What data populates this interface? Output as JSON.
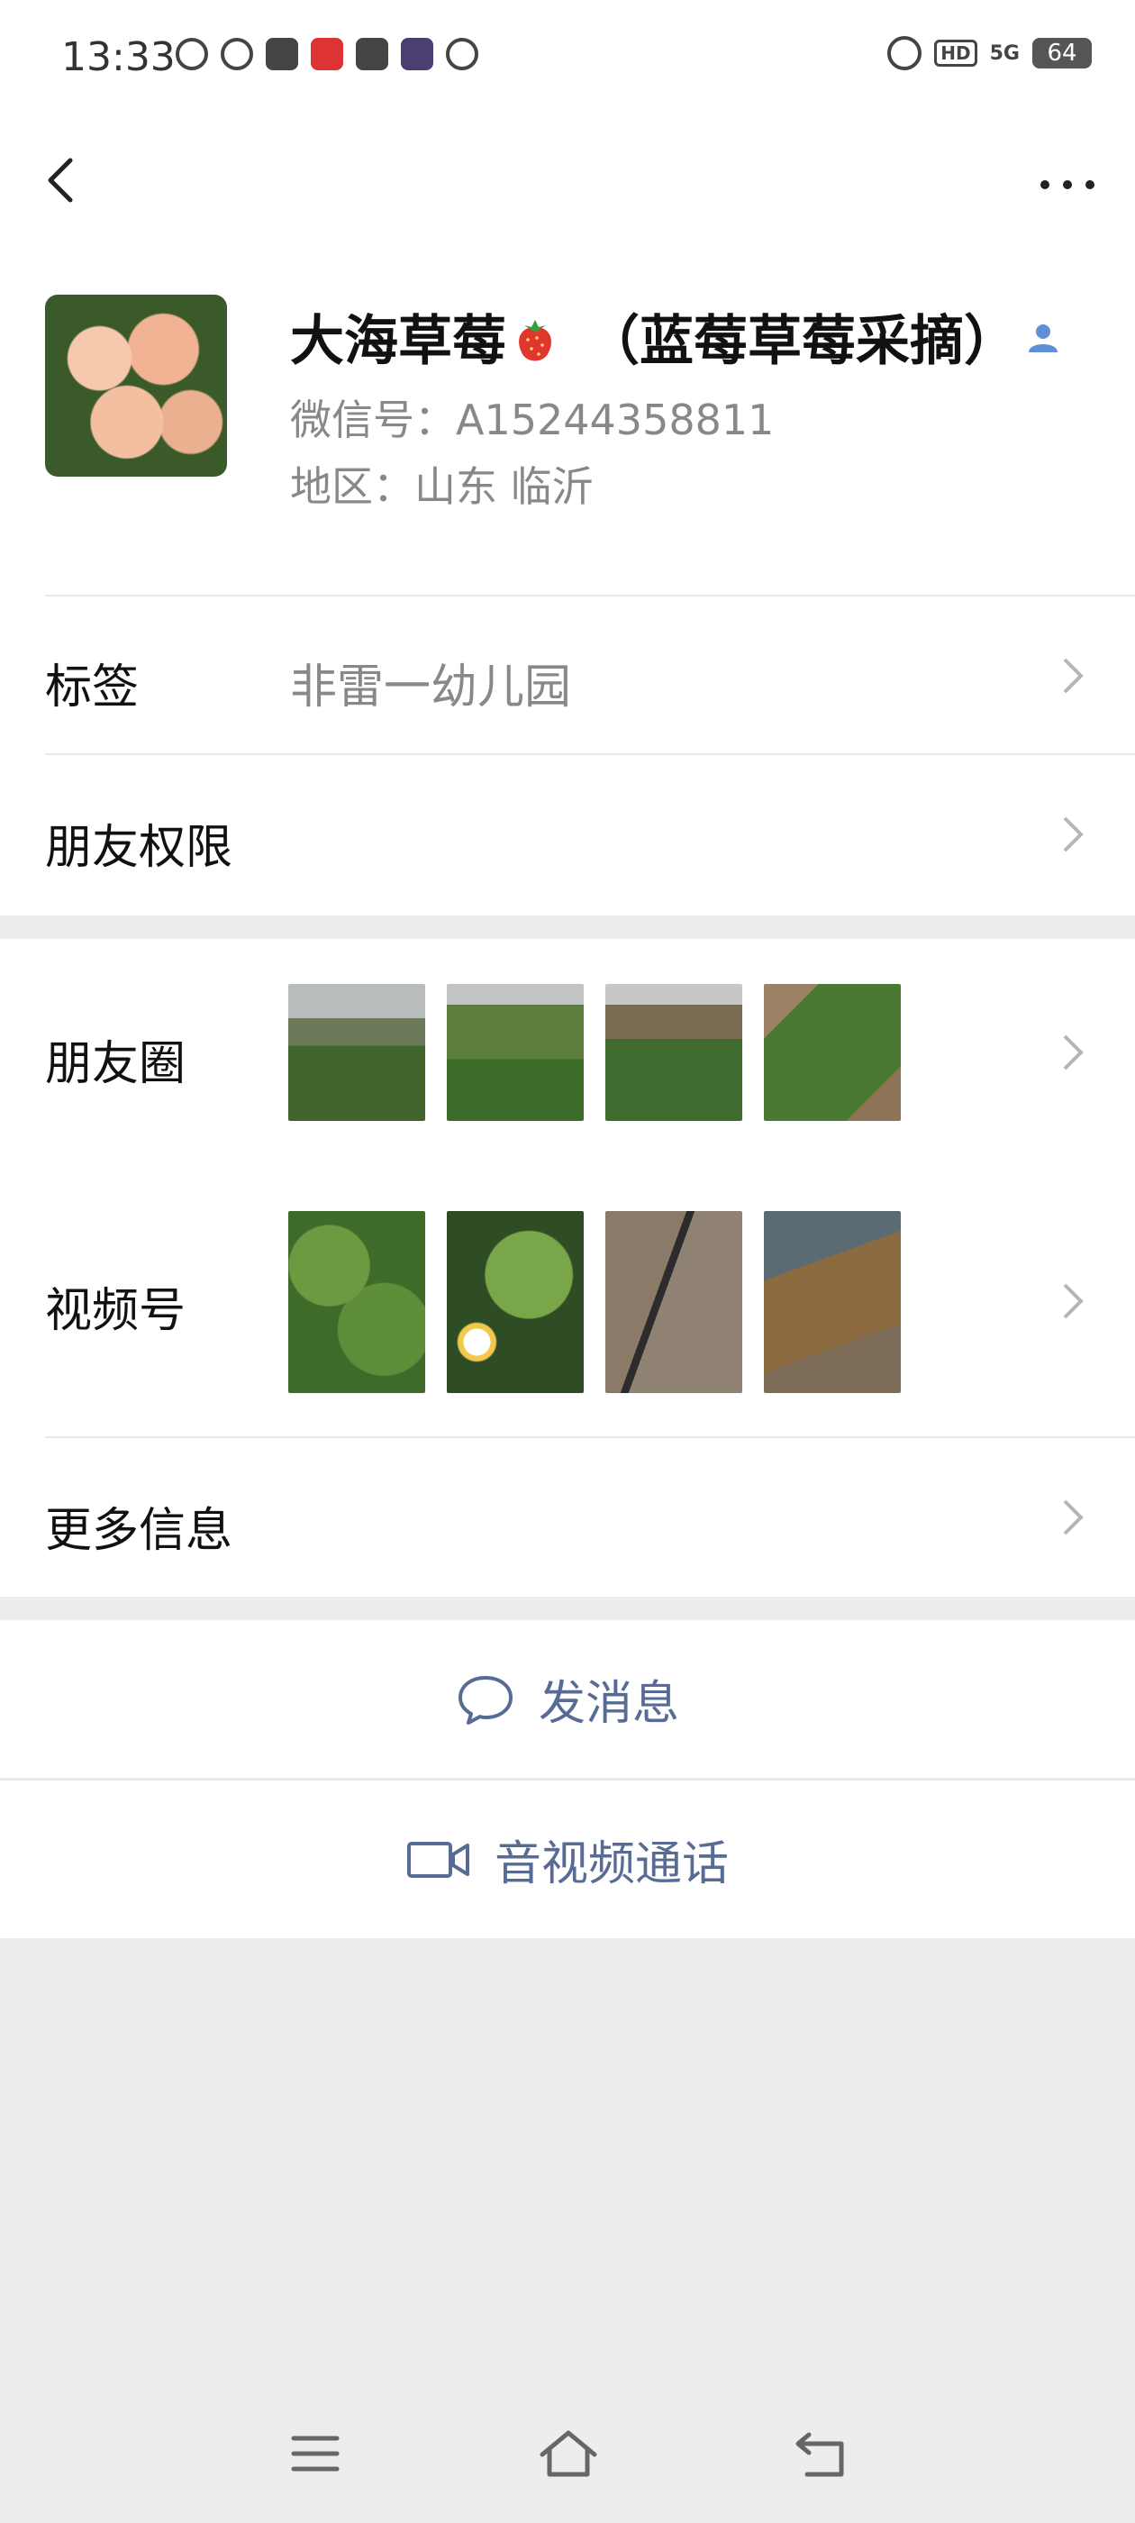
{
  "status_bar": {
    "time": "13:33",
    "battery": "64",
    "network": "5G",
    "hd": "HD"
  },
  "nav": {
    "back_icon": "chevron-left-icon",
    "more_icon": "more-dots-icon"
  },
  "profile": {
    "name": "大海草莓",
    "name_suffix": "（蓝莓草莓采摘）",
    "wechat_id": "微信号：A15244358811",
    "region": "地区：山东  临沂"
  },
  "rows": {
    "tag_label": "标签",
    "tag_value": "非雷一幼儿园",
    "permission_label": "朋友权限",
    "moments_label": "朋友圈",
    "channels_label": "视频号",
    "more_info_label": "更多信息"
  },
  "actions": {
    "message_label": "发消息",
    "call_label": "音视频通话"
  },
  "colors": {
    "link": "#576b95",
    "background": "#ededed"
  }
}
